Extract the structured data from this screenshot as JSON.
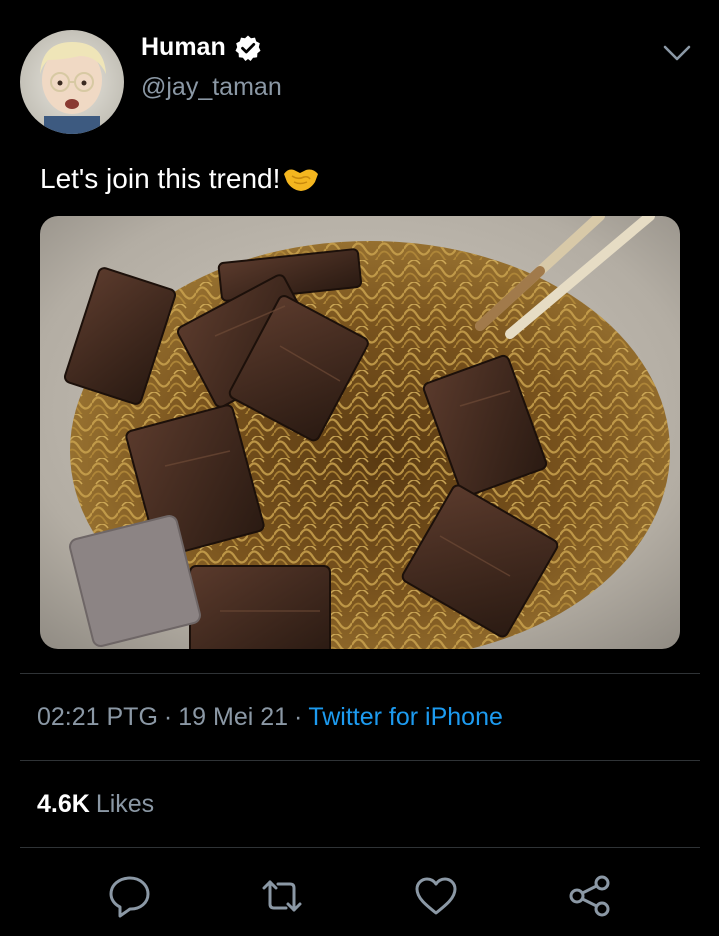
{
  "author": {
    "name": "Human",
    "handle": "@jay_taman",
    "verified": true
  },
  "tweet": {
    "text": "Let's join this trend!",
    "emoji": "handshake-icon",
    "media_description": "photo"
  },
  "meta": {
    "time": "02:21 PTG",
    "separator": "·",
    "date": "19 Mei 21",
    "source": "Twitter for iPhone"
  },
  "stats": {
    "likes_count": "4.6K",
    "likes_label": "Likes"
  },
  "actions": [
    {
      "icon": "reply-icon"
    },
    {
      "icon": "retweet-icon"
    },
    {
      "icon": "like-icon"
    },
    {
      "icon": "share-icon"
    }
  ],
  "colors": {
    "background": "#000000",
    "secondary_text": "#8b98a5",
    "link": "#1d9bf0",
    "divider": "#2f3336"
  }
}
